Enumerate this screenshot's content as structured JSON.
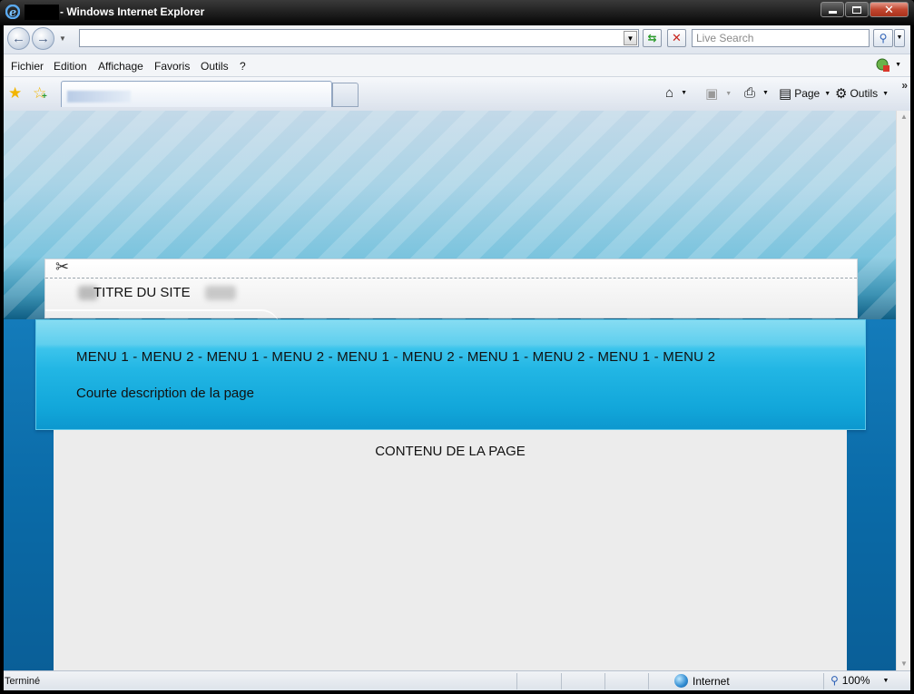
{
  "window": {
    "title": "- Windows Internet Explorer",
    "title_icon": "ie-logo-icon"
  },
  "address_bar": {
    "url_value": "",
    "search_placeholder": "Live Search"
  },
  "menu_bar": {
    "items": [
      "Fichier",
      "Edition",
      "Affichage",
      "Favoris",
      "Outils",
      "?"
    ]
  },
  "command_bar": {
    "page_label": "Page",
    "tools_label": "Outils"
  },
  "page": {
    "site_title": "TITRE DU SITE",
    "menu_line": "MENU 1 - MENU 2 - MENU 1 - MENU 2 - MENU 1 - MENU 2 - MENU 1 - MENU 2 - MENU 1 - MENU 2",
    "description": "Courte description de la page",
    "content": "CONTENU DE LA PAGE"
  },
  "status_bar": {
    "status": "Terminé",
    "zone": "Internet",
    "zoom": "100%"
  },
  "colors": {
    "menu_band": "#22b6e4",
    "content_bg": "#ececec",
    "page_bg": "#0a6aa7"
  }
}
